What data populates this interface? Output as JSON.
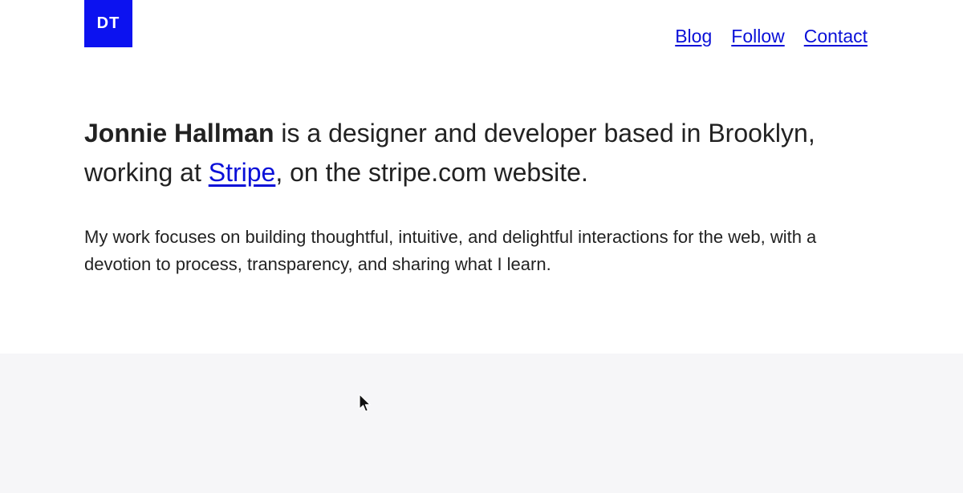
{
  "logo": {
    "text": "DT",
    "color": "#0c12f0"
  },
  "nav": {
    "items": [
      {
        "label": "Blog"
      },
      {
        "label": "Follow"
      },
      {
        "label": "Contact"
      }
    ],
    "link_color": "#0a10d8"
  },
  "intro": {
    "name": "Jonnie Hallman",
    "text_1": " is a designer and developer based in Brooklyn, working at ",
    "link": "Stripe",
    "text_2": ", on the stripe.com website."
  },
  "description": "My work focuses on building thoughtful, intuitive, and delightful interactions for the web, with a devotion to process, transparency, and sharing what I learn.",
  "colors": {
    "background": "#ffffff",
    "lower_section": "#f6f6f8",
    "text": "#222222"
  },
  "cursor": {
    "icon": "mouse-pointer-icon"
  }
}
